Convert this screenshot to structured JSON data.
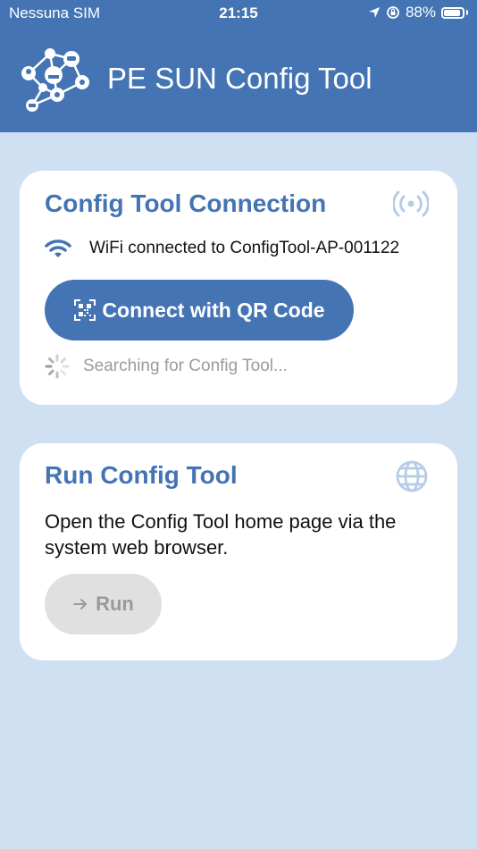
{
  "status_bar": {
    "carrier": "Nessuna SIM",
    "time": "21:15",
    "battery_percent": "88%",
    "battery_level": 0.88
  },
  "header": {
    "title": "PE SUN Config Tool",
    "background_color": "#4474b3"
  },
  "connection_card": {
    "title": "Config Tool Connection",
    "status_icon": "broadcast-icon",
    "wifi_icon": "wifi-icon",
    "wifi_status": "WiFi connected to ConfigTool-AP-001122",
    "qr_button_label": "Connect with QR Code",
    "qr_button_icon": "qr-code-icon",
    "searching_icon": "spinner-icon",
    "searching_text": "Searching for Config Tool..."
  },
  "run_card": {
    "title": "Run Config Tool",
    "icon": "globe-icon",
    "description": "Open the Config Tool home page via the system web browser.",
    "run_button_label": "Run",
    "run_button_icon": "arrow-right-icon"
  },
  "colors": {
    "accent": "#4474b3",
    "page_background": "#cfe0f2",
    "card_background": "#ffffff",
    "disabled_button": "#e0e0e0",
    "muted_text": "#9b9b9b",
    "faint_icon": "#b6cde7"
  }
}
